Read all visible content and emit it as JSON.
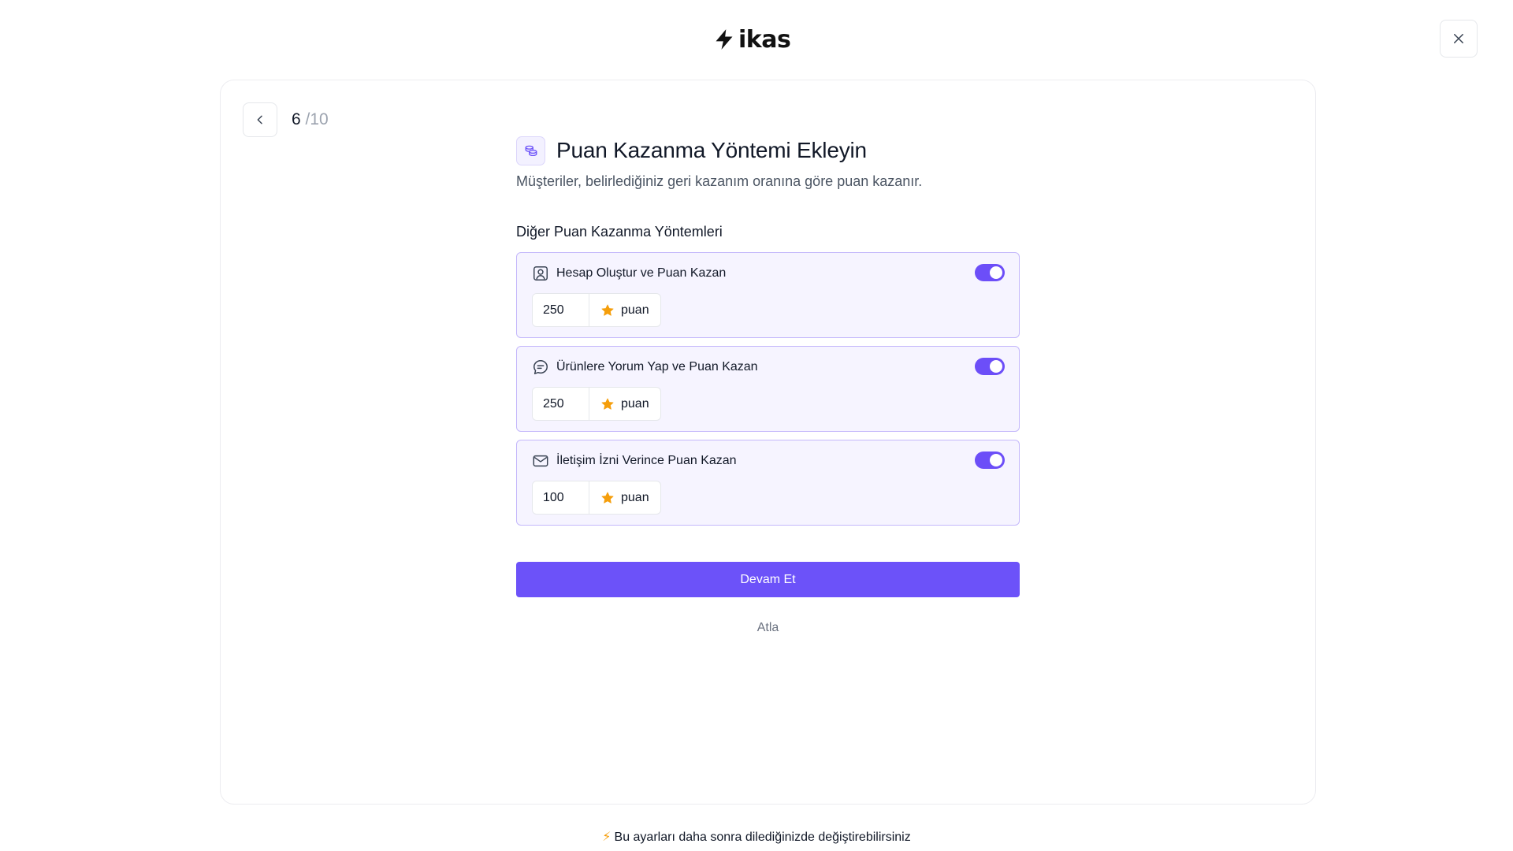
{
  "brand": {
    "name": "ikas"
  },
  "progress": {
    "current": "6",
    "total": "/10"
  },
  "header": {
    "title": "Puan Kazanma Yöntemi Ekleyin",
    "subtitle": "Müşteriler, belirlediğiniz geri kazanım oranına göre puan kazanır."
  },
  "section": {
    "label": "Diğer Puan Kazanma Yöntemleri"
  },
  "methods": [
    {
      "label": "Hesap Oluştur ve Puan Kazan",
      "value": "250",
      "unit": "puan",
      "enabled": true,
      "icon": "user-square-icon"
    },
    {
      "label": "Ürünlere Yorum Yap ve Puan Kazan",
      "value": "250",
      "unit": "puan",
      "enabled": true,
      "icon": "chat-icon"
    },
    {
      "label": "İletişim İzni Verince Puan Kazan",
      "value": "100",
      "unit": "puan",
      "enabled": true,
      "icon": "mail-icon"
    }
  ],
  "actions": {
    "continue_label": "Devam Et",
    "skip_label": "Atla"
  },
  "footer": {
    "note": "Bu ayarları daha sonra dilediğinizde değiştirebilirsiniz",
    "icon": "lightning-icon"
  },
  "colors": {
    "accent": "#6C52F9",
    "star": "#F59E0B",
    "card_bg": "#F6F4FF",
    "card_border": "#C4B8FB"
  }
}
